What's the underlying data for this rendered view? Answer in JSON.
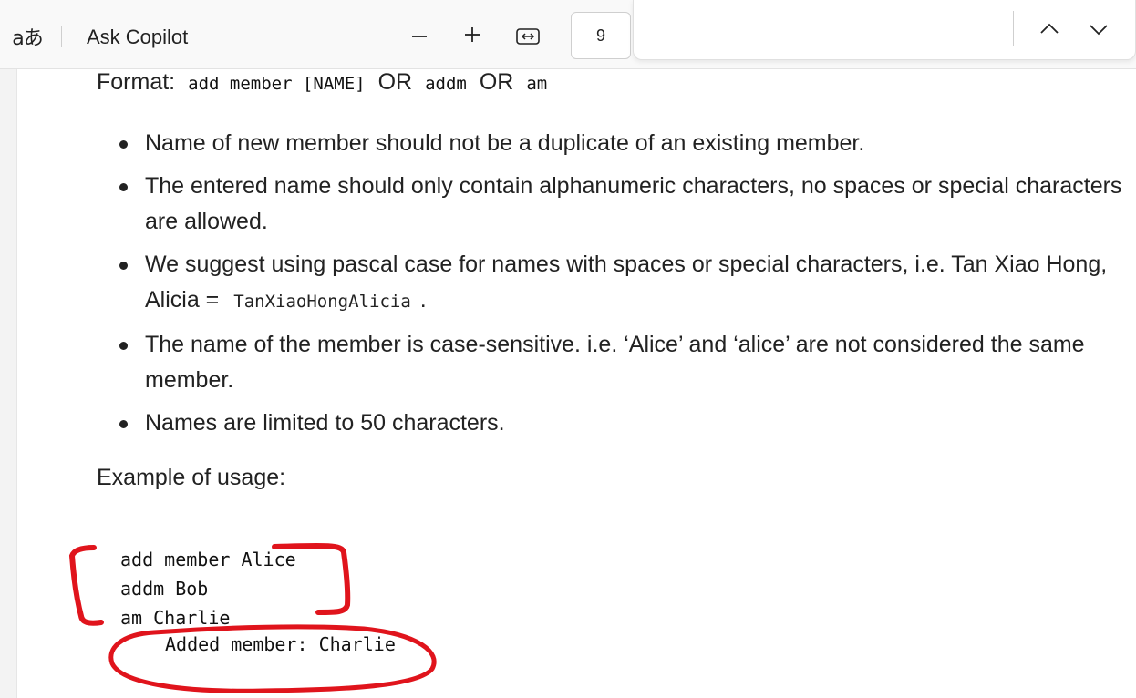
{
  "toolbar": {
    "translate_glyph": "aあ",
    "ask_copilot": "Ask Copilot",
    "page_number": "9",
    "icons": [
      "translate-icon",
      "zoom-out-icon",
      "zoom-in-icon",
      "fit-width-icon",
      "chevron-up-icon",
      "chevron-down-icon"
    ]
  },
  "document": {
    "format_label": "Format:",
    "format_cmd1": "add member [NAME]",
    "or1": "OR",
    "format_cmd2": "addm",
    "or2": "OR",
    "format_cmd3": "am",
    "bullets": [
      "Name of new member should not be a duplicate of an existing member.",
      "The entered name should only contain alphanumeric characters, no spaces or special characters are allowed.",
      "We suggest using pascal case for names with spaces or special characters, i.e. Tan Xiao Hong, Alicia =",
      "The name of the member is case-sensitive. i.e. ‘Alice’ and ‘alice’ are not considered the same member.",
      "Names are limited to 50 characters."
    ],
    "bullet3_code": "TanXiaoHongAlicia",
    "bullet3_suffix": ".",
    "example_heading": "Example of usage:",
    "code_lines": [
      "add member Alice",
      "addm Bob",
      "am Charlie"
    ],
    "code_output": "Added member: Charlie"
  },
  "colors": {
    "annotation_red": "#e0141c",
    "toolbar_bg": "#f9f9f9",
    "page_bg": "#ffffff"
  }
}
